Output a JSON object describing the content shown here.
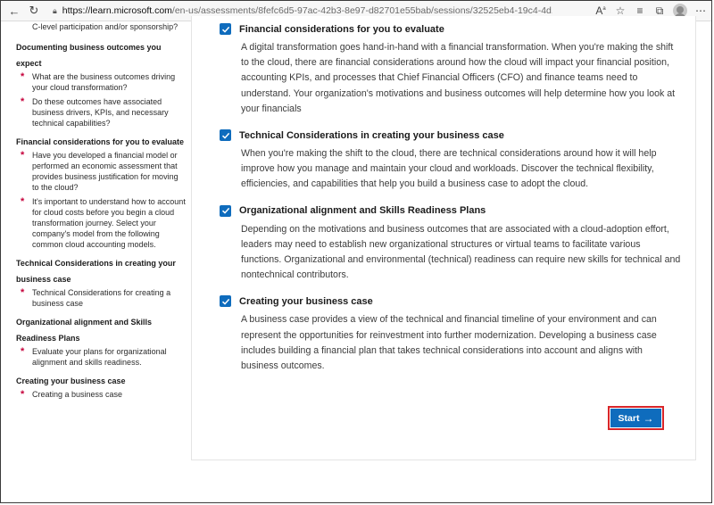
{
  "browser": {
    "url_host": "https://learn.microsoft.com",
    "url_path": "/en-us/assessments/8fefc6d5-97ac-42b3-8e97-d82701e55bab/sessions/32525eb4-19c4-4d..."
  },
  "sidebar": {
    "top_fragment": "C-level participation and/or sponsorship?",
    "sections": [
      {
        "title": "Documenting business outcomes you expect",
        "items": [
          "What are the business outcomes driving your cloud transformation?",
          "Do these outcomes have associated business drivers, KPIs, and necessary technical capabilities?"
        ]
      },
      {
        "title": "Financial considerations for you to evaluate",
        "items": [
          "Have you developed a financial model or performed an economic assessment that provides business justification for moving to the cloud?",
          "It's important to understand how to account for cloud costs before you begin a cloud transformation journey. Select your company's model from the following common cloud accounting models."
        ]
      },
      {
        "title": "Technical Considerations in creating your business case",
        "items": [
          "Technical Considerations for creating a business case"
        ]
      },
      {
        "title": "Organizational alignment and Skills Readiness Plans",
        "items": [
          "Evaluate your plans for organizational alignment and skills readiness."
        ]
      },
      {
        "title": "Creating your business case",
        "items": [
          "Creating a business case"
        ]
      }
    ]
  },
  "considerations": [
    {
      "title": "Financial considerations for you to evaluate",
      "description": "A digital transformation goes hand-in-hand with a financial transformation. When you're making the shift to the cloud, there are financial considerations around how the cloud will impact your financial position, accounting KPIs, and processes that Chief Financial Officers (CFO) and finance teams need to understand. Your organization's motivations and business outcomes will help determine how you look at your financials",
      "checked": true
    },
    {
      "title": "Technical Considerations in creating your business case",
      "description": "When you're making the shift to the cloud, there are technical considerations around how it will help improve how you manage and maintain your cloud and workloads. Discover the technical flexibility, efficiencies, and capabilities that help you build a business case to adopt the cloud.",
      "checked": true
    },
    {
      "title": "Organizational alignment and Skills Readiness Plans",
      "description": "Depending on the motivations and business outcomes that are associated with a cloud-adoption effort, leaders may need to establish new organizational structures or virtual teams to facilitate various functions. Organizational and environmental (technical) readiness can require new skills for technical and nontechnical contributors.",
      "checked": true
    },
    {
      "title": "Creating your business case",
      "description": "A business case provides a view of the technical and financial timeline of your environment and can represent the opportunities for reinvestment into further modernization. Developing a business case includes building a financial plan that takes technical considerations into account and aligns with business outcomes.",
      "checked": true
    }
  ],
  "start_button": {
    "label": "Start"
  },
  "colors": {
    "accent": "#0f6cbd",
    "asterisk": "#c5003a",
    "highlight": "#d8262a"
  }
}
